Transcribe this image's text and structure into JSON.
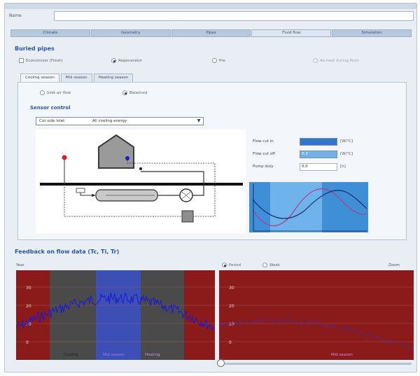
{
  "name_label": "Name",
  "name_value": "",
  "tabs": [
    "Climate",
    "Geometry",
    "Pipes",
    "Fluid flow",
    "Simulation"
  ],
  "active_tab_index": 3,
  "buried_pipes": {
    "title": "Buried pipes",
    "options": [
      {
        "label": "Economizer (Fresh)",
        "type": "checkbox",
        "checked": false
      },
      {
        "label": "Regenerator",
        "type": "radio",
        "checked": true
      },
      {
        "label": "Pre",
        "type": "radio",
        "checked": false
      },
      {
        "label": "Re-heat during flush",
        "type": "radio",
        "checked": false
      }
    ]
  },
  "subtabs": [
    "Cooling season",
    "Mid season",
    "Heating season"
  ],
  "active_subtab_index": 0,
  "mode_radios": [
    {
      "label": "Inlet air flow",
      "checked": false
    },
    {
      "label": "Balanced",
      "checked": true
    }
  ],
  "section_title": "Sensor control",
  "dropdown": {
    "left": "Cut side inlet",
    "right": "All cooling energy"
  },
  "params": [
    {
      "label": "Flow cut in",
      "value": "",
      "unit": "[W/°C]"
    },
    {
      "label": "Flow cut off",
      "value": "0.3",
      "unit": "[W/°C]"
    },
    {
      "label": "Pump duty",
      "value": "0.0",
      "unit": "[h]"
    }
  ],
  "feedback": {
    "title": "Feedback on flow data (Tc, Ti, Tr)",
    "left_label": "Year",
    "radios": [
      {
        "label": "Period",
        "checked": true
      },
      {
        "label": "Week",
        "checked": false
      }
    ],
    "right_label": "Zoom",
    "y_ticks": [
      "30",
      "20",
      "10",
      "0"
    ],
    "left_captions": [
      "Cooling",
      "Mid season",
      "Heating"
    ],
    "right_caption": "Mid season"
  },
  "slider_position": 0.0,
  "colors": {
    "accent_blue": "#2b57a0",
    "plot_red": "#8b1a1a",
    "plot_grey": "#4a4a4a",
    "plot_selected": "#3b4fb5",
    "series_line": "#1a1ad8",
    "series_dotted": "#4a2aa8",
    "mini_plot_bg": "#3e8fd6",
    "mini_plot_highlight": "#6eb3ec"
  }
}
